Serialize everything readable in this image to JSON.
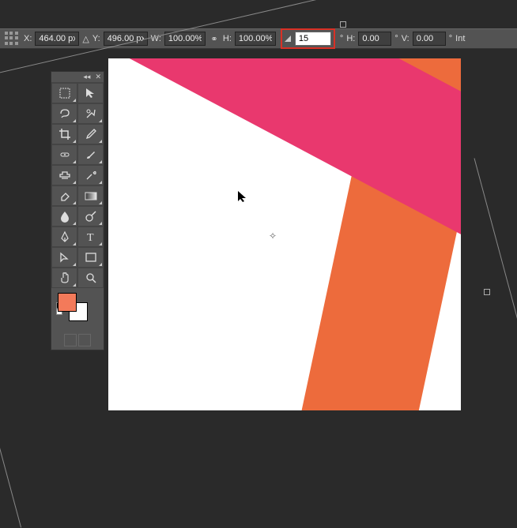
{
  "options": {
    "x_label": "X:",
    "x_value": "464.00 px",
    "tri1": "△",
    "y_label": "Y:",
    "y_value": "496.00 px",
    "w_label": "W:",
    "w_value": "100.00%",
    "link": "⚭",
    "h_label": "H:",
    "h_value": "100.00%",
    "rot_value": "15",
    "deg": "°",
    "skewH_label": "H:",
    "skewH_value": "0.00",
    "skewV_label": "V:",
    "skewV_value": "0.00",
    "int_label": "Int"
  },
  "tools": {
    "collapse": "◂◂",
    "close": "✕",
    "items": {
      "marquee": "rectangular-marquee",
      "move": "move-tool",
      "lasso": "lasso-tool",
      "quickselect": "quick-selection-tool",
      "crop": "crop-tool",
      "eyedropper": "eyedropper-tool",
      "healing": "spot-healing-tool",
      "brush": "brush-tool",
      "stamp": "clone-stamp-tool",
      "history": "history-brush-tool",
      "eraser": "eraser-tool",
      "gradient": "gradient-tool",
      "blur": "blur-tool",
      "dodge": "dodge-tool",
      "pen": "pen-tool",
      "type": "type-tool",
      "path": "path-selection-tool",
      "rectangle": "rectangle-tool",
      "hand": "hand-tool",
      "zoom": "zoom-tool"
    }
  },
  "colors": {
    "foreground": "#f37a5a",
    "background": "#ffffff",
    "pink": "#e9386e",
    "orange": "#ed6b3c"
  }
}
